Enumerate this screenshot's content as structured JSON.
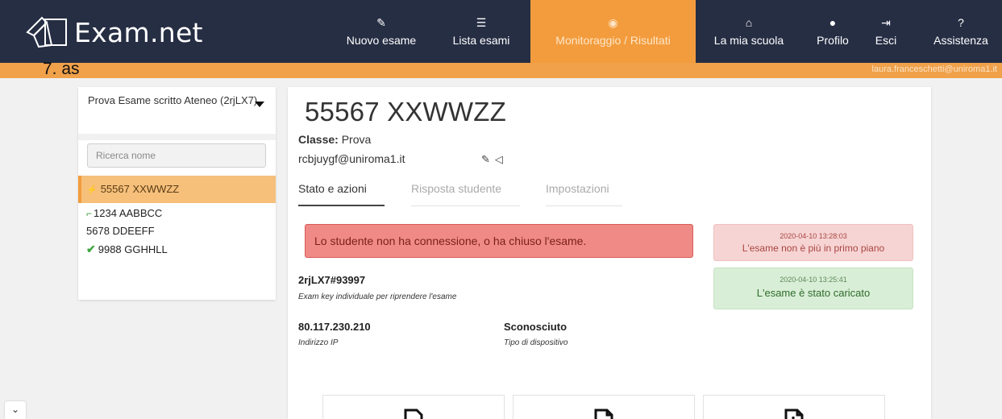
{
  "app": {
    "name": "Exam.net"
  },
  "nav": {
    "items": [
      {
        "label": "Nuovo esame",
        "icon": "pencil-icon"
      },
      {
        "label": "Lista esami",
        "icon": "list-icon"
      },
      {
        "label": "Monitoraggio / Risultati",
        "icon": "eye-icon",
        "active": true
      },
      {
        "label": "La mia scuola",
        "icon": "home-icon"
      },
      {
        "label": "Profilo",
        "icon": "user-icon"
      },
      {
        "label": "Esci",
        "icon": "sign-out-icon"
      },
      {
        "label": "Assistenza",
        "icon": "question-circle-icon"
      }
    ],
    "user_email": "laura.franceschetti@uniroma1.it"
  },
  "overlay": {
    "text": "7.  as"
  },
  "sidebar": {
    "exam_select": "Prova Esame scritto Ateneo (2rjLX7)",
    "search_placeholder": "Ricerca nome",
    "students": [
      {
        "label": "55567 XXWWZZ",
        "status": "active"
      },
      {
        "label": "1234 AABBCC",
        "status": "exited"
      },
      {
        "label": "5678 DDEEFF",
        "status": "none"
      },
      {
        "label": "9988 GGHHLL",
        "status": "submitted"
      }
    ]
  },
  "student": {
    "title": "55567 XXWWZZ",
    "class_label": "Classe:",
    "class_value": "Prova",
    "email": "rcbjuygf@uniroma1.it",
    "tabs": [
      {
        "label": "Stato e azioni",
        "active": true
      },
      {
        "label": "Risposta studente",
        "active": false
      },
      {
        "label": "Impostazioni",
        "active": false
      }
    ],
    "alert": "Lo studente non ha connessione, o ha chiuso l'esame.",
    "exam_key": "2rjLX7#93997",
    "exam_key_label": "Exam key individuale per riprendere l'esame",
    "ip": "80.117.230.210",
    "ip_label": "Indirizzo IP",
    "device": "Sconosciuto",
    "device_label": "Tipo di dispositivo"
  },
  "events": [
    {
      "time": "2020-04-10 13:28:03",
      "message": "L'esame non è più in primo piano",
      "type": "red"
    },
    {
      "time": "2020-04-10 13:25:41",
      "message": "L'esame è stato caricato",
      "type": "green"
    }
  ],
  "colors": {
    "navbar": "#262e44",
    "accent": "#f39c3d",
    "alert_red": "#f08a86",
    "event_green": "#d9eed7"
  }
}
